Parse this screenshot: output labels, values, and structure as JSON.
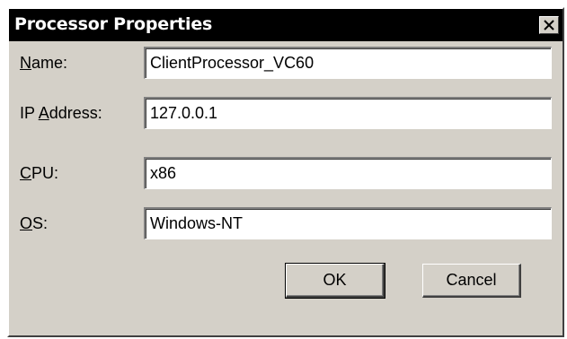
{
  "window": {
    "title": "Processor Properties",
    "close_icon": "close-icon"
  },
  "fields": {
    "name": {
      "label_mnemonic": "N",
      "label_rest": "ame:",
      "value": "ClientProcessor_VC60"
    },
    "ip": {
      "label_prefix": "IP ",
      "label_mnemonic": "A",
      "label_rest": "ddress:",
      "value": "127.0.0.1"
    },
    "cpu": {
      "label_mnemonic": "C",
      "label_rest": "PU:",
      "value": "x86"
    },
    "os": {
      "label_mnemonic": "O",
      "label_rest": "S:",
      "value": "Windows-NT"
    }
  },
  "buttons": {
    "ok_label": "OK",
    "cancel_label": "Cancel"
  },
  "colors": {
    "titlebar": "#000000",
    "face": "#d4d0c8",
    "field": "#ffffff"
  }
}
